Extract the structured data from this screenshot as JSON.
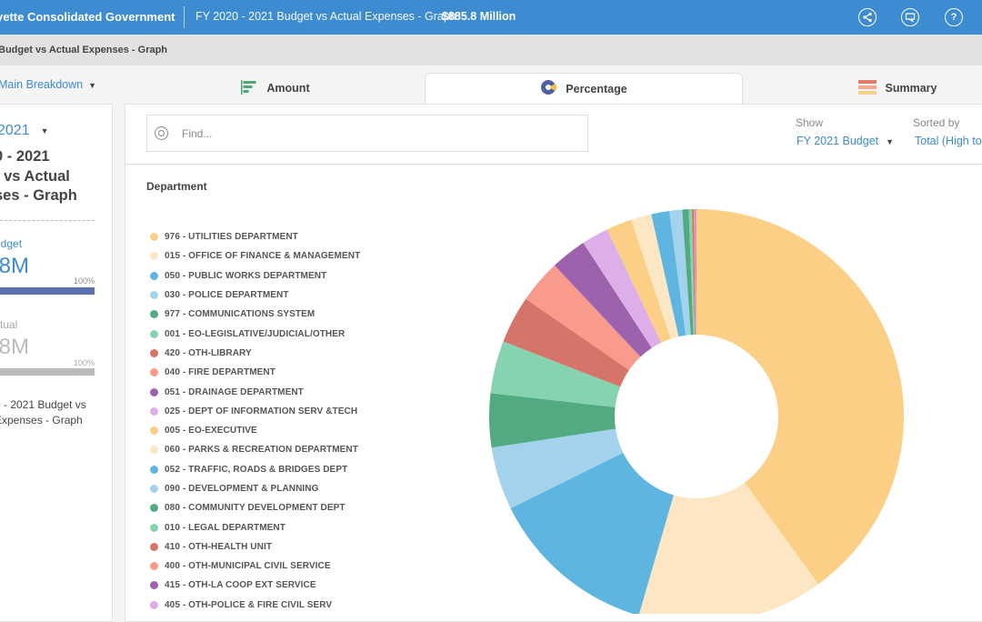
{
  "header": {
    "org_name": "yette Consolidated Government",
    "title": "FY 2020 - 2021 Budget vs Actual Expenses - Graph",
    "total": "$885.8 Million",
    "icons": [
      "share-icon",
      "comment-icon",
      "help-icon"
    ],
    "help_glyph": "?"
  },
  "breadcrumb": {
    "current": "Budget vs Actual Expenses - Graph"
  },
  "breakdown": {
    "label": "Main Breakdown"
  },
  "tabs": [
    {
      "label": "Amount",
      "active": false
    },
    {
      "label": "Percentage",
      "active": true
    },
    {
      "label": "Summary",
      "active": false
    }
  ],
  "sidebar": {
    "year": "2021",
    "heading": "0 - 2021\nt vs Actual\nses - Graph",
    "budget": {
      "label": "udget",
      "value": ".8M",
      "pct_label": "100%",
      "pct": 100,
      "color": "#5a6fb0"
    },
    "actual": {
      "label": "ctual",
      "value": ".8M",
      "pct_label": "100%",
      "pct": 100,
      "color": "#bbbbbb"
    },
    "description": "0 - 2021 Budget vs\nExpenses - Graph"
  },
  "toolbar": {
    "search_placeholder": "Find...",
    "show_label": "Show",
    "show_value": "FY 2021 Budget",
    "sort_label": "Sorted by",
    "sort_value": "Total (High to"
  },
  "chart_data": {
    "type": "pie",
    "title": "Department",
    "variant": "donut",
    "legend_position": "left",
    "unit": "percent of FY 2021 Budget (estimated from slice angles)",
    "slices": [
      {
        "label": "976 - UTILITIES DEPARTMENT",
        "value": 40.0,
        "color": "#fbcf86"
      },
      {
        "label": "015 - OFFICE OF FINANCE & MANAGEMENT",
        "value": 14.5,
        "color": "#fde6c3"
      },
      {
        "label": "050 - PUBLIC WORKS DEPARTMENT",
        "value": 13.2,
        "color": "#5db5e0"
      },
      {
        "label": "030 - POLICE DEPARTMENT",
        "value": 4.9,
        "color": "#a2d2ec"
      },
      {
        "label": "977 - COMMUNICATIONS SYSTEM",
        "value": 4.2,
        "color": "#52aa80"
      },
      {
        "label": "001 - EO-LEGISLATIVE/JUDICIAL/OTHER",
        "value": 4.1,
        "color": "#86d3b0"
      },
      {
        "label": "420 - OTH-LIBRARY",
        "value": 3.7,
        "color": "#d57468"
      },
      {
        "label": "040 - FIRE DEPARTMENT",
        "value": 3.4,
        "color": "#f89b8c"
      },
      {
        "label": "051 - DRAINAGE DEPARTMENT",
        "value": 2.8,
        "color": "#9d62ae"
      },
      {
        "label": "025 - DEPT OF INFORMATION SERV &TECH",
        "value": 2.1,
        "color": "#ddaee8"
      },
      {
        "label": "005 - EO-EXECUTIVE",
        "value": 2.0,
        "color": "#fbcf86"
      },
      {
        "label": "060 - PARKS & RECREATION DEPARTMENT",
        "value": 1.6,
        "color": "#fde6c3"
      },
      {
        "label": "052 - TRAFFIC, ROADS & BRIDGES DEPT",
        "value": 1.4,
        "color": "#5db5e0"
      },
      {
        "label": "090 - DEVELOPMENT & PLANNING",
        "value": 1.0,
        "color": "#a2d2ec"
      },
      {
        "label": "080 - COMMUNITY DEVELOPMENT DEPT",
        "value": 0.5,
        "color": "#52aa80"
      },
      {
        "label": "010 - LEGAL DEPARTMENT",
        "value": 0.25,
        "color": "#86d3b0"
      },
      {
        "label": "410 - OTH-HEALTH UNIT",
        "value": 0.15,
        "color": "#d57468"
      },
      {
        "label": "400 - OTH-MUNICIPAL CIVIL SERVICE",
        "value": 0.1,
        "color": "#f89b8c"
      },
      {
        "label": "415 - OTH-LA COOP EXT SERVICE",
        "value": 0.05,
        "color": "#9d62ae"
      },
      {
        "label": "405 - OTH-POLICE & FIRE CIVIL SERV",
        "value": 0.05,
        "color": "#ddaee8"
      }
    ]
  }
}
